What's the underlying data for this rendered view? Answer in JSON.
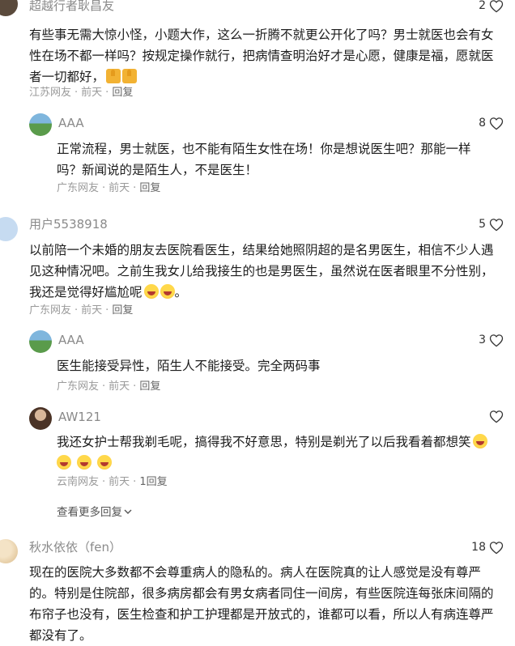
{
  "comments": [
    {
      "username": "超越行者耿昌友",
      "likes": "2",
      "text": "有些事无需大惊小怪，小题大作，这么一折腾不就更公开化了吗？男士就医也会有女性在场不都一样吗？按规定操作就行，把病情查明治好才是心愿，健康是福，愿就医者一切都好，",
      "meta_source": "江苏网友",
      "meta_time": "前天",
      "reply_label": "回复"
    },
    {
      "username": "AAA",
      "likes": "8",
      "text": "正常流程，男士就医，也不能有陌生女性在场！你是想说医生吧？那能一样吗？新闻说的是陌生人，不是医生！",
      "meta_source": "广东网友",
      "meta_time": "前天",
      "reply_label": "回复"
    },
    {
      "username": "用户5538918",
      "likes": "5",
      "text": "以前陪一个未婚的朋友去医院看医生，结果给她照阴超的是名男医生，相信不少人遇见这种情况吧。之前生我女儿给我接生的也是男医生，虽然说在医者眼里不分性别，我还是觉得好尴尬呢",
      "text_tail": "。",
      "meta_source": "广东网友",
      "meta_time": "前天",
      "reply_label": "回复"
    },
    {
      "username": "AAA",
      "likes": "3",
      "text": "医生能接受异性，陌生人不能接受。完全两码事",
      "meta_source": "广东网友",
      "meta_time": "前天",
      "reply_label": "回复"
    },
    {
      "username": "AW121",
      "likes": "",
      "text": "我还女护士帮我剃毛呢，搞得我不好意思，特别是剃光了以后我看着都想笑",
      "meta_source": "云南网友",
      "meta_time": "前天",
      "reply_label": "1回复"
    },
    {
      "username": "秋水依依（fen）",
      "likes": "18",
      "text": "现在的医院大多数都不会尊重病人的隐私的。病人在医院真的让人感觉是没有尊严的。特别是住院部，很多病房都会有男女病者同住一间房，有些医院连每张床间隔的布帘子也没有，医生检查和护工护理都是开放式的，谁都可以看，所以人有病连尊严都没有了。"
    }
  ],
  "view_more": "查看更多回复",
  "sep": "·",
  "icons": {
    "like": "heart-outline-icon",
    "emoji_thumb": "thumbs-up-emoji",
    "emoji_laugh": "laughing-emoji",
    "chevron": "chevron-down-icon"
  },
  "colors": {
    "meta": "#9a9a9a",
    "username": "#8a8a8a",
    "text": "#1c1c1c"
  }
}
